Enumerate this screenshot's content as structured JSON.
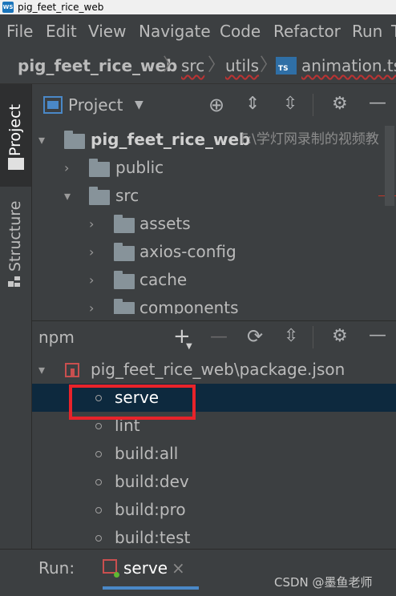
{
  "titlebar": {
    "app_icon": "webstorm-icon",
    "title": "pig_feet_rice_web"
  },
  "menu": [
    "File",
    "Edit",
    "View",
    "Navigate",
    "Code",
    "Refactor",
    "Run",
    "T"
  ],
  "breadcrumb": {
    "project": "pig_feet_rice_web",
    "src": "src",
    "utils": "utils",
    "file": "animation.ts"
  },
  "left_tabs": {
    "project": "Project",
    "structure": "Structure"
  },
  "project_panel": {
    "view_label": "Project",
    "icons": [
      "locate-icon",
      "expand-all-icon",
      "collapse-all-icon",
      "gear-icon",
      "minimize-icon"
    ],
    "tree": {
      "root": {
        "name": "pig_feet_rice_web",
        "path": "F:\\学灯网录制的视频教"
      },
      "items": [
        "public",
        "src",
        "assets",
        "axios-config",
        "cache",
        "components"
      ]
    }
  },
  "npm_panel": {
    "title": "npm",
    "package": "pig_feet_rice_web\\package.json",
    "scripts": [
      "serve",
      "lint",
      "build:all",
      "build:dev",
      "build:pro",
      "build:test"
    ],
    "selected": "serve"
  },
  "run_bar": {
    "label": "Run:",
    "tab": "serve",
    "close": "×"
  },
  "watermark": "CSDN @墨鱼老师",
  "colors": {
    "accent": "#4a88c7",
    "highlight_box": "#e8232a",
    "selection": "#0d293e",
    "background": "#3c3f41"
  }
}
